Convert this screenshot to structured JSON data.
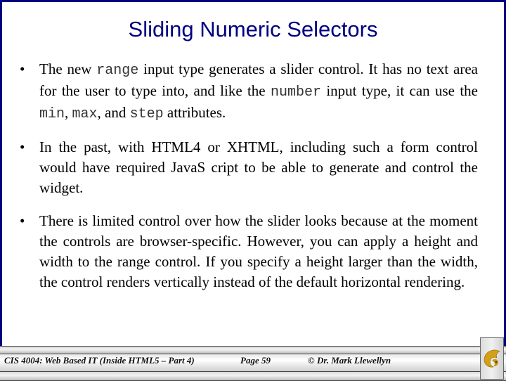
{
  "slide": {
    "title": "Sliding Numeric Selectors",
    "bullets": [
      {
        "parts": [
          {
            "text": "The new ",
            "code": false
          },
          {
            "text": "range",
            "code": true
          },
          {
            "text": " input type generates a slider control.  It has no text area for the user to type into, and like the ",
            "code": false
          },
          {
            "text": "number",
            "code": true
          },
          {
            "text": "  input type, it can use the ",
            "code": false
          },
          {
            "text": "min",
            "code": true
          },
          {
            "text": ", ",
            "code": false
          },
          {
            "text": "max",
            "code": true
          },
          {
            "text": ", and ",
            "code": false
          },
          {
            "text": "step",
            "code": true
          },
          {
            "text": " attributes.",
            "code": false
          }
        ]
      },
      {
        "parts": [
          {
            "text": "In the past, with HTML4 or XHTML, including such a form control would have required JavaS cript to be able to generate and control the widget.",
            "code": false
          }
        ]
      },
      {
        "parts": [
          {
            "text": "There is limited control over how the slider looks because at the moment the controls are browser-specific.  However, you can apply a height and width to the range control.  If you specify a height larger than the width, the control renders vertically instead of the default horizontal rendering.",
            "code": false
          }
        ]
      }
    ],
    "bullet_glyph": "•"
  },
  "footer": {
    "course": "CIS 4004: Web Based IT (Inside HTML5 – Part 4)",
    "page": "Page 59",
    "copyright": "© Dr. Mark Llewellyn",
    "logo_icon": "ucf-pegasus-logo-icon"
  },
  "colors": {
    "title": "#000080",
    "frame": "#000080",
    "logo_gold": "#d4a017"
  }
}
